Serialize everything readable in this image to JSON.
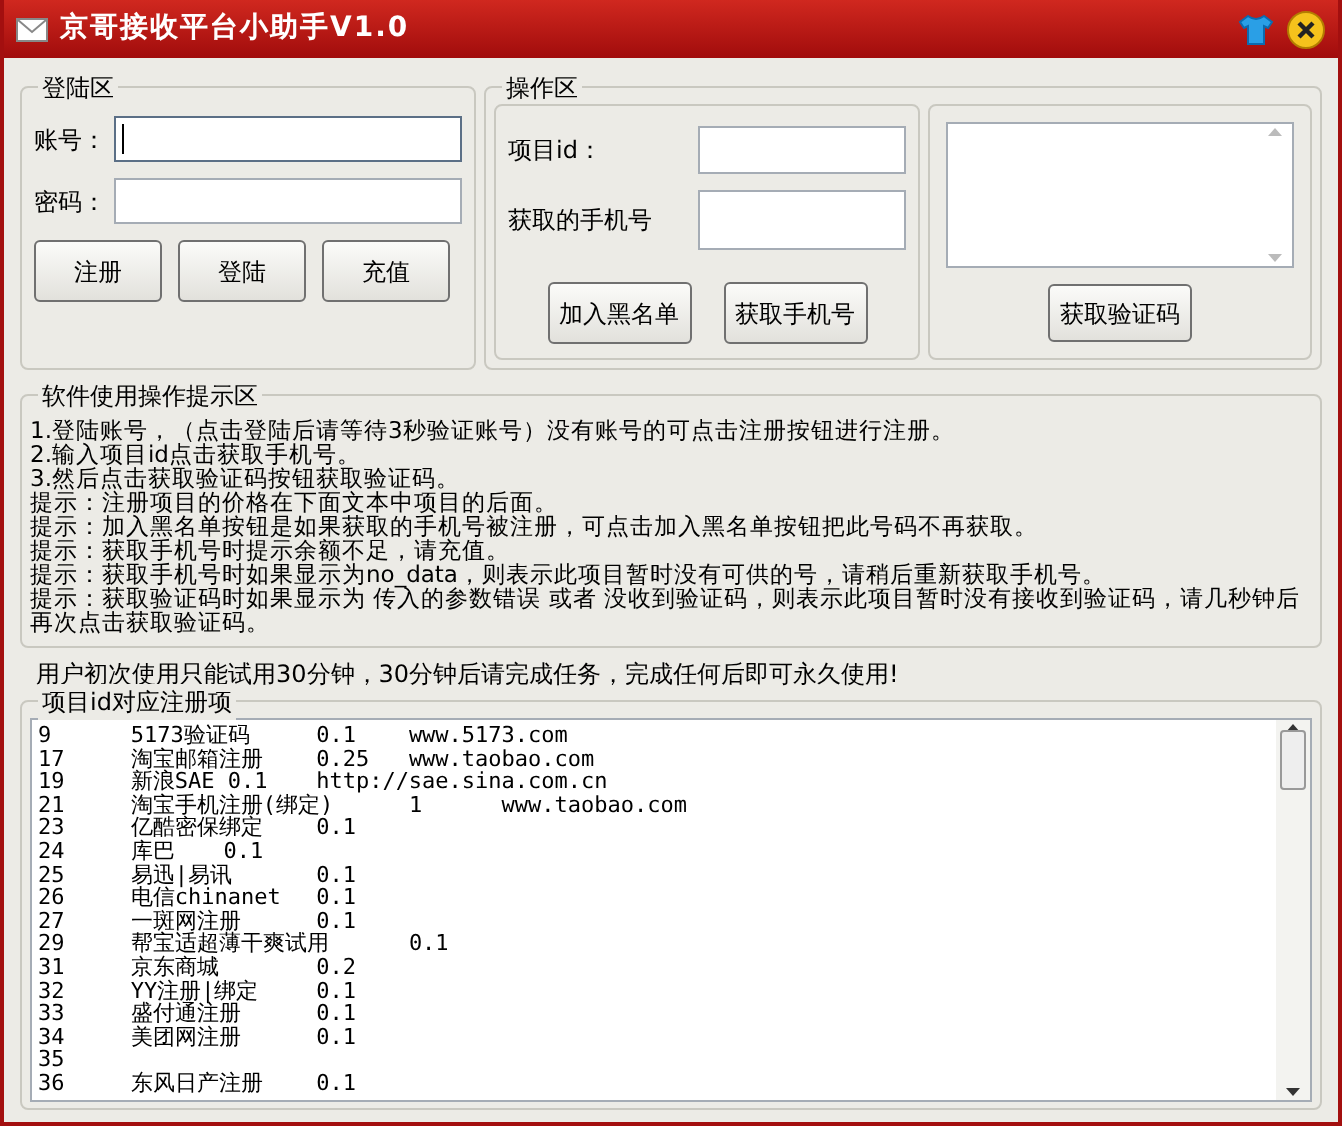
{
  "window": {
    "title": "京哥接收平台小助手V1.0"
  },
  "login": {
    "title": "登陆区",
    "fields": [
      {
        "label": "账号：",
        "focused": true
      },
      {
        "label": "密码：",
        "focused": false
      }
    ],
    "buttons": [
      "注册",
      "登陆",
      "充值"
    ]
  },
  "operation": {
    "title": "操作区",
    "fields": [
      {
        "label": "项目id："
      },
      {
        "label": "获取的手机号"
      }
    ],
    "buttons": [
      "加入黑名单",
      "获取手机号"
    ],
    "code_button": "获取验证码"
  },
  "tips": {
    "title": "软件使用操作提示区",
    "lines": [
      "1.登陆账号，（点击登陆后请等待3秒验证账号）没有账号的可点击注册按钮进行注册。",
      "2.输入项目id点击获取手机号。",
      "3.然后点击获取验证码按钮获取验证码。",
      "提示：注册项目的价格在下面文本中项目的后面。",
      "提示：加入黑名单按钮是如果获取的手机号被注册，可点击加入黑名单按钮把此号码不再获取。",
      "提示：获取手机号时提示余额不足，请充值。",
      "提示：获取手机号时如果显示为no_data，则表示此项目暂时没有可供的号，请稍后重新获取手机号。",
      "提示：获取验证码时如果显示为 传入的参数错误 或者 没收到验证码，则表示此项目暂时没有接收到验证码，请几秒钟后再次点击获取验证码。"
    ]
  },
  "notice": "用户初次使用只能试用30分钟，30分钟后请完成任务，完成任何后即可永久使用!",
  "projects": {
    "title": "项目id对应注册项",
    "rows": [
      "9\t5173验证码\t0.1\twww.5173.com",
      "17\t淘宝邮箱注册\t0.25\twww.taobao.com",
      "19\t新浪SAE 0.1\thttp://sae.sina.com.cn",
      "21\t淘宝手机注册(绑定)\t1\twww.taobao.com",
      "23\t亿酷密保绑定\t0.1",
      "24\t库巴\t0.1",
      "25\t易迅|易讯\t0.1",
      "26\t电信chinanet\t0.1",
      "27\t一斑网注册\t0.1",
      "29\t帮宝适超薄干爽试用\t0.1",
      "31\t京东商城\t0.2",
      "32\tYY注册|绑定\t0.1",
      "33\t盛付通注册\t0.1",
      "34\t美团网注册\t0.1",
      "35",
      "36\t东风日产注册\t0.1"
    ]
  }
}
